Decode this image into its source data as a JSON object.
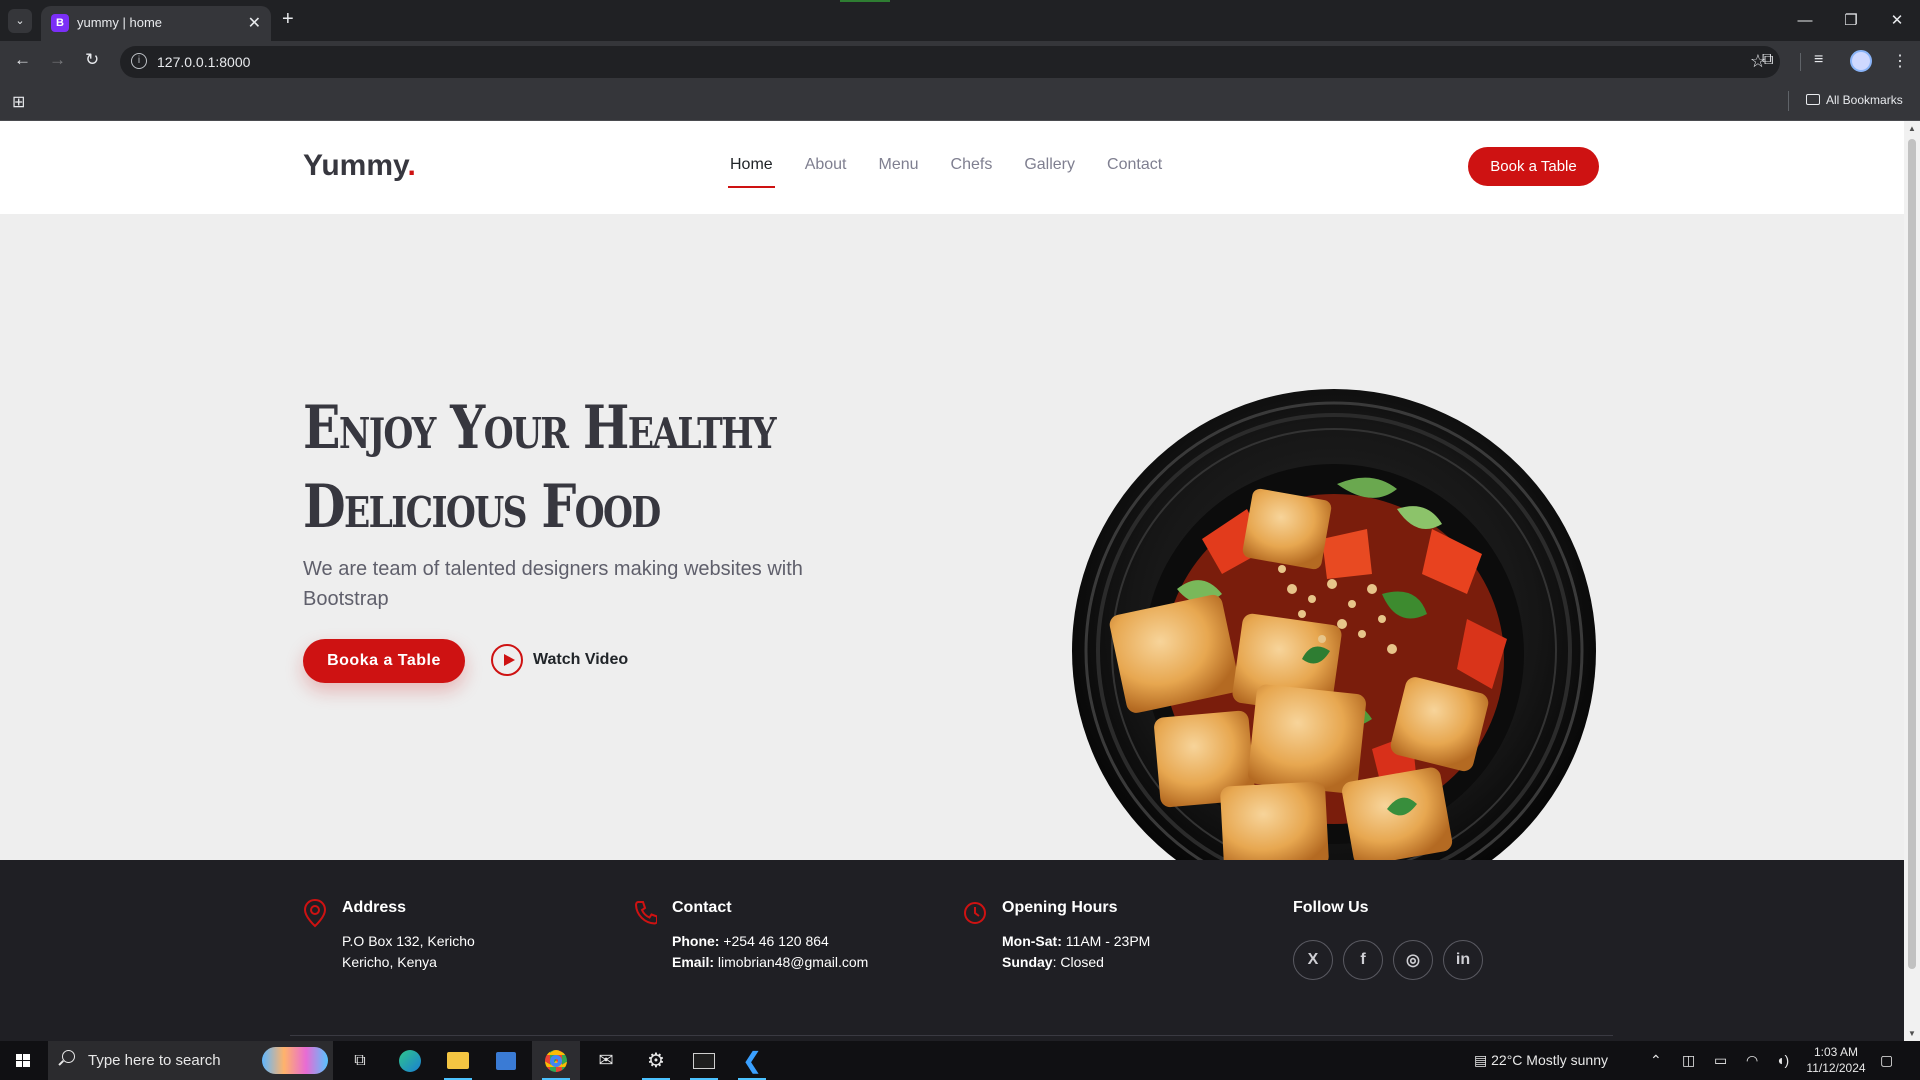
{
  "browser": {
    "tab_title": "yummy | home",
    "tab_favicon_letter": "B",
    "url": "127.0.0.1:8000",
    "bookmarks_label": "All Bookmarks"
  },
  "site": {
    "logo": "Yummy",
    "logo_dot": ".",
    "nav": [
      "Home",
      "About",
      "Menu",
      "Chefs",
      "Gallery",
      "Contact"
    ],
    "header_button": "Book a Table",
    "accent_color": "#ce1212"
  },
  "hero": {
    "title_line1": "Enjoy Your Healthy",
    "title_line2": "Delicious Food",
    "subtitle": "We are team of talented designers making websites with Bootstrap",
    "primary_button": "Booka a Table",
    "video_link": "Watch Video"
  },
  "footer": {
    "address": {
      "title": "Address",
      "line1": "P.O Box 132, Kericho",
      "line2": "Kericho, Kenya"
    },
    "contact": {
      "title": "Contact",
      "phone_label": "Phone:",
      "phone": "+254 46 120 864",
      "email_label": "Email:",
      "email": "limobrian48@gmail.com"
    },
    "hours": {
      "title": "Opening Hours",
      "weekday_label": "Mon-Sat:",
      "weekday": "11AM - 23PM",
      "sunday_label": "Sunday",
      "sunday": ": Closed"
    },
    "follow": {
      "title": "Follow Us",
      "x": "X",
      "facebook": "f",
      "instagram": "◎",
      "linkedin": "in"
    }
  },
  "taskbar": {
    "search_placeholder": "Type here to search",
    "weather": "22°C  Mostly sunny",
    "time": "1:03 AM",
    "date": "11/12/2024"
  }
}
